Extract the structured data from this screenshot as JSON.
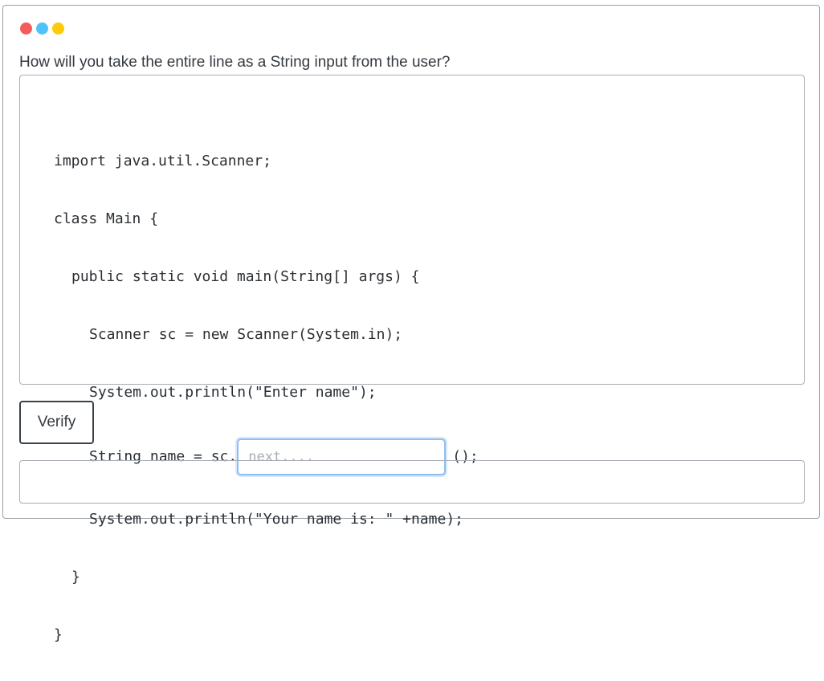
{
  "window": {
    "dots": [
      {
        "name": "close",
        "color": "#f45b5b"
      },
      {
        "name": "minimize",
        "color": "#4fc3f7"
      },
      {
        "name": "maximize",
        "color": "#ffca0a"
      }
    ]
  },
  "question": {
    "text": "How will you take the entire line as a String input from the user?"
  },
  "code": {
    "lines": [
      "import java.util.Scanner;",
      "class Main {",
      "public static void main(String[] args) {",
      "Scanner sc = new Scanner(System.in);",
      "System.out.println(\"Enter name\");"
    ],
    "input_line_prefix": "String name = sc.",
    "input_line_suffix": "();",
    "after_lines": [
      "System.out.println(\"Your name is: \" +name);",
      "}",
      "}"
    ]
  },
  "answer": {
    "placeholder": "next....",
    "value": ""
  },
  "verify": {
    "label": "Verify"
  },
  "result": {
    "text": ""
  }
}
